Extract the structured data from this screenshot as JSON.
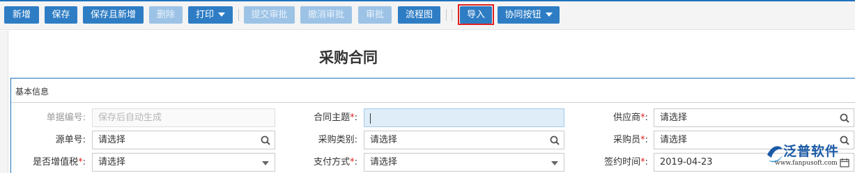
{
  "toolbar": {
    "buttons": {
      "new": "新增",
      "save": "保存",
      "save_new": "保存且新增",
      "delete": "删除",
      "print": "打印",
      "submit": "提交审批",
      "cancel_approval": "撤消审批",
      "approve": "审批",
      "flowchart": "流程图",
      "import": "导入",
      "collab": "协同按钮"
    }
  },
  "page": {
    "title": "采购合同"
  },
  "section": {
    "title": "基本信息"
  },
  "form": {
    "doc_no": {
      "label": "单据编号:",
      "value": "保存后自动生成"
    },
    "subject": {
      "label": "合同主题",
      "suffix": ":",
      "value": ""
    },
    "supplier": {
      "label": "供应商",
      "suffix": ":",
      "placeholder": "请选择"
    },
    "source_no": {
      "label": "源单号:",
      "placeholder": "请选择"
    },
    "purchase_type": {
      "label": "采购类别:",
      "placeholder": "请选择"
    },
    "buyer": {
      "label": "采购员",
      "suffix": ":",
      "placeholder": "请选择"
    },
    "vat": {
      "label": "是否增值税",
      "suffix": ":",
      "placeholder": "请选择"
    },
    "pay_method": {
      "label": "支付方式",
      "suffix": ":",
      "placeholder": "请选择"
    },
    "sign_date": {
      "label": "签约时间",
      "suffix": ":",
      "value": "2019-04-23"
    }
  },
  "required_mark": "*",
  "logo": {
    "text": "泛普软件",
    "url": "www.fanpusoft.com"
  },
  "colors": {
    "primary": "#2e7dc4",
    "disabled": "#9cc3e6",
    "required": "#e02020",
    "brand": "#1a5aa6"
  }
}
